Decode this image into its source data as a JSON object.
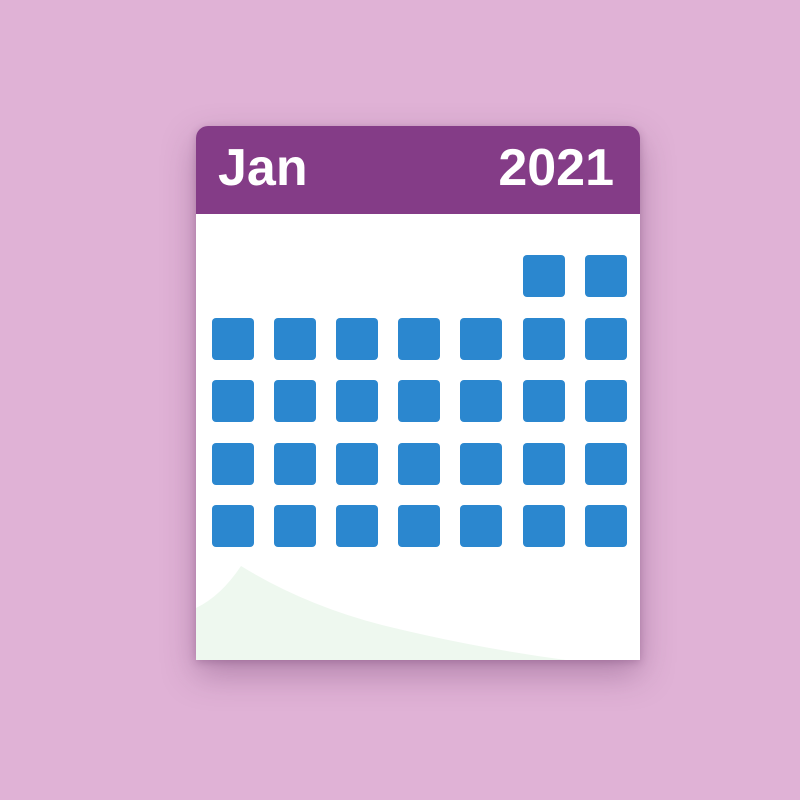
{
  "calendar": {
    "month": "Jan",
    "year": "2021",
    "leading_blank_days": 5,
    "days_shown": 30,
    "columns": 7,
    "icon": "calendar-icon"
  },
  "colors": {
    "background": "#e0b2d6",
    "header": "#843c87",
    "sheet": "#ffffff",
    "day_square": "#2b87cf",
    "page_curl": "#eef8ef",
    "header_text": "#ffffff"
  }
}
